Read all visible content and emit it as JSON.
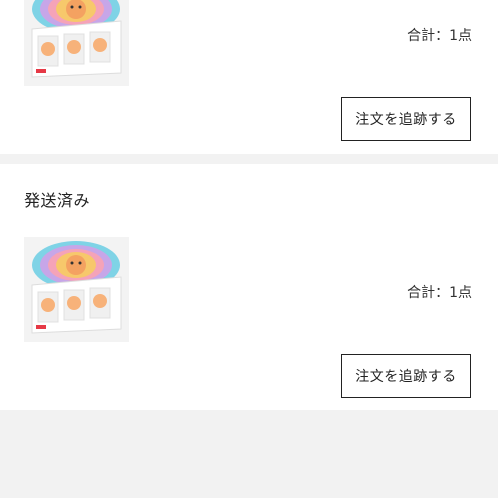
{
  "orders": [
    {
      "status": "",
      "total_label": "合計：1点",
      "track_button": "注文を追跡する",
      "product_image_icon": "product-box-image"
    },
    {
      "status": "発送済み",
      "total_label": "合計：1点",
      "track_button": "注文を追跡する",
      "product_image_icon": "product-box-image"
    }
  ]
}
